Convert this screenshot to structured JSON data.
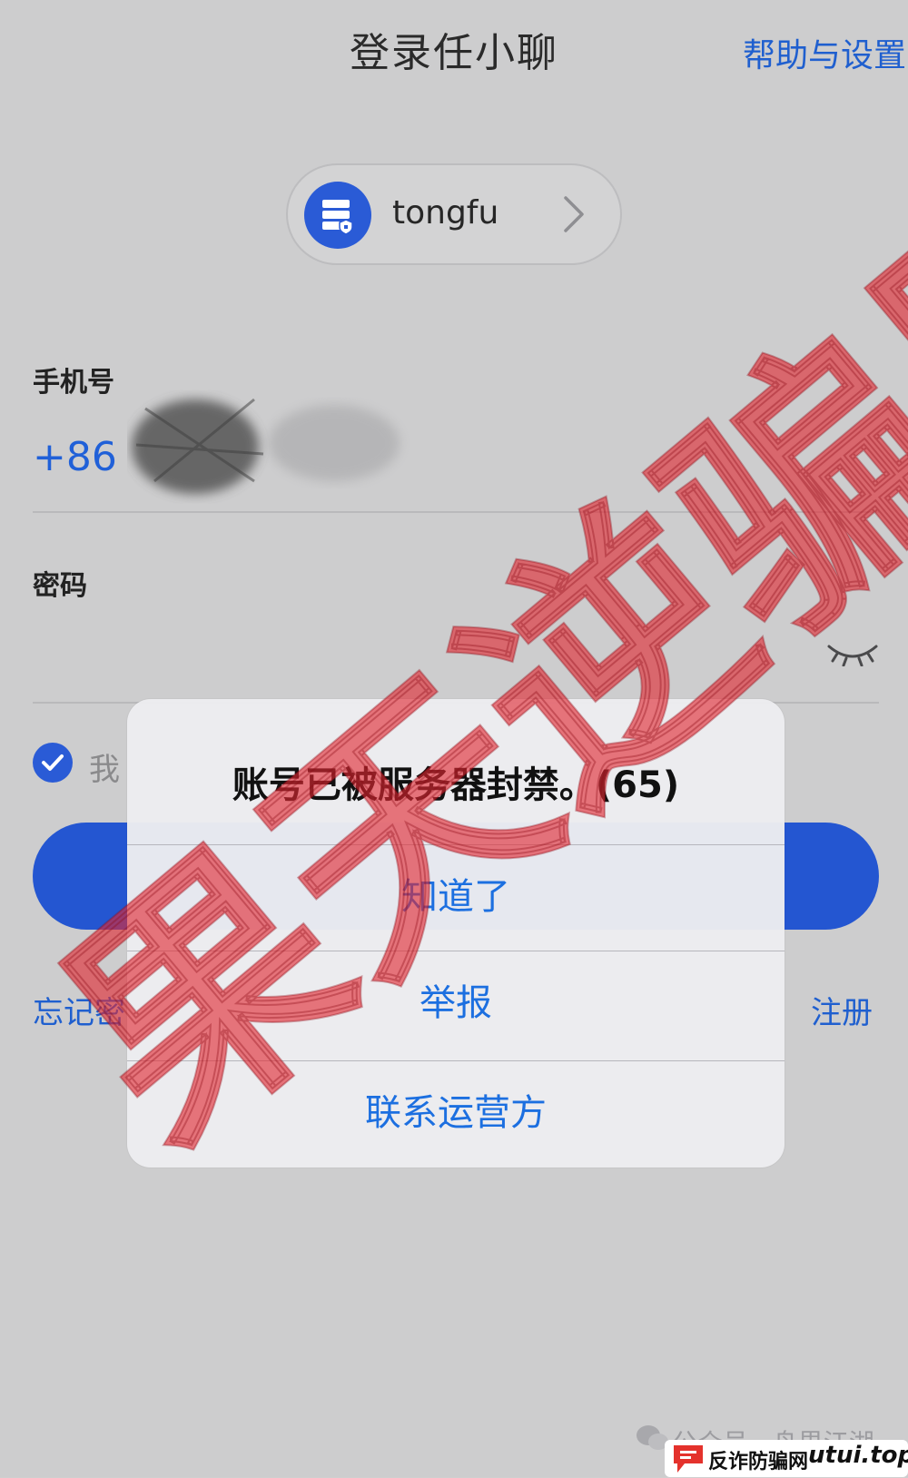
{
  "header": {
    "title": "登录任小聊",
    "help_link": "帮助与设置"
  },
  "server": {
    "name": "tongfu",
    "icon": "server-shield-icon"
  },
  "phone": {
    "label": "手机号",
    "country_code": "+86"
  },
  "password": {
    "label": "密码",
    "visibility_icon": "eye-closed-icon"
  },
  "agreement": {
    "checked": true,
    "text_visible": "我"
  },
  "links": {
    "forgot_visible": "忘记密",
    "register": "注册"
  },
  "alert": {
    "message": "账号已被服务器封禁。(65)",
    "buttons": [
      "知道了",
      "举报",
      "联系运营方"
    ]
  },
  "watermark": {
    "text": "果天逆骗局"
  },
  "footer": {
    "credit": "公众号 · 舟界江湖",
    "site_name": "反诈防骗网",
    "site_domain": "utui.top"
  },
  "colors": {
    "accent_blue": "#2456d1",
    "link_blue": "#1f5fcf",
    "watermark_red": "#e02832"
  }
}
